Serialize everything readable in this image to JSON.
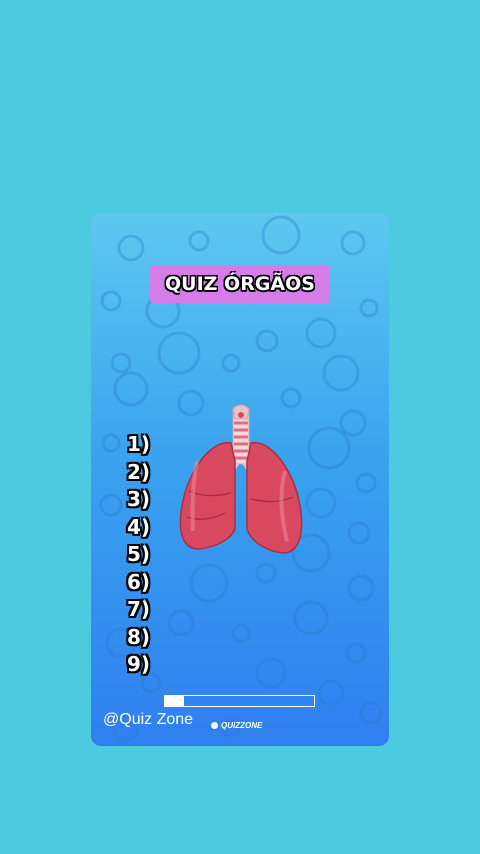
{
  "quiz": {
    "title": "QUIZ ÓRGÃOS",
    "image_icon": "lungs-icon",
    "answer_slots": [
      "1)",
      "2)",
      "3)",
      "4)",
      "5)",
      "6)",
      "7)",
      "8)",
      "9)"
    ],
    "progress_fraction": 0.13
  },
  "footer": {
    "handle": "@Quiz Zone",
    "brand": "QUIZZONE"
  },
  "colors": {
    "page_background": "#4ccbe0",
    "title_background": "#d67ce8",
    "card_top": "#5ec8f0",
    "card_bottom": "#2f7ff0",
    "lung": "#d8485f"
  }
}
